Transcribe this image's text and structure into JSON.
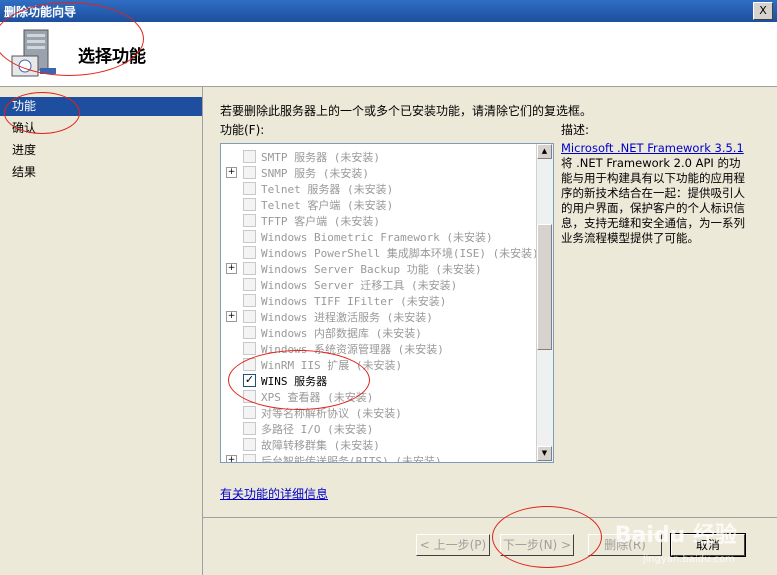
{
  "window": {
    "title": "删除功能向导",
    "close_label": "X"
  },
  "header": {
    "title": "选择功能"
  },
  "nav": {
    "items": [
      {
        "label": "功能"
      },
      {
        "label": "确认"
      },
      {
        "label": "进度"
      },
      {
        "label": "结果"
      }
    ]
  },
  "main": {
    "instruction": "若要删除此服务器上的一个或多个已安装功能，请清除它们的复选框。",
    "features_label": "功能(F):",
    "description_label": "描述:",
    "features": [
      {
        "label": "SMTP 服务器  (未安装)",
        "expander": false,
        "checked": false
      },
      {
        "label": "SNMP 服务  (未安装)",
        "expander": true,
        "checked": false
      },
      {
        "label": "Telnet 服务器  (未安装)",
        "expander": false,
        "checked": false
      },
      {
        "label": "Telnet 客户端  (未安装)",
        "expander": false,
        "checked": false
      },
      {
        "label": "TFTP 客户端  (未安装)",
        "expander": false,
        "checked": false
      },
      {
        "label": "Windows Biometric Framework  (未安装)",
        "expander": false,
        "checked": false
      },
      {
        "label": "Windows PowerShell 集成脚本环境(ISE)  (未安装)",
        "expander": false,
        "checked": false
      },
      {
        "label": "Windows Server Backup 功能  (未安装)",
        "expander": true,
        "checked": false
      },
      {
        "label": "Windows Server 迁移工具  (未安装)",
        "expander": false,
        "checked": false
      },
      {
        "label": "Windows TIFF IFilter  (未安装)",
        "expander": false,
        "checked": false
      },
      {
        "label": "Windows 进程激活服务  (未安装)",
        "expander": true,
        "checked": false
      },
      {
        "label": "Windows 内部数据库  (未安装)",
        "expander": false,
        "checked": false
      },
      {
        "label": "Windows 系统资源管理器  (未安装)",
        "expander": false,
        "checked": false
      },
      {
        "label": "WinRM IIS 扩展  (未安装)",
        "expander": false,
        "checked": false
      },
      {
        "label": "WINS 服务器",
        "expander": false,
        "checked": true
      },
      {
        "label": "XPS 查看器  (未安装)",
        "expander": false,
        "checked": false
      },
      {
        "label": "对等名称解析协议  (未安装)",
        "expander": false,
        "checked": false
      },
      {
        "label": "多路径 I/O  (未安装)",
        "expander": false,
        "checked": false
      },
      {
        "label": "故障转移群集  (未安装)",
        "expander": false,
        "checked": false
      },
      {
        "label": "后台智能传送服务(BITS)  (未安装)",
        "expander": true,
        "checked": false
      }
    ],
    "description_link": "Microsoft .NET Framework 3.5.1",
    "description_text": "将 .NET Framework 2.0 API 的功能与用于构建具有以下功能的应用程序的新技术结合在一起：提供吸引人的用户界面，保护客户的个人标识信息，支持无缝和安全通信，为一系列业务流程模型提供了可能。",
    "more_info_link": "有关功能的详细信息"
  },
  "buttons": {
    "previous": "< 上一步(P)",
    "next": "下一步(N) >",
    "delete": "删除(R)",
    "cancel": "取消"
  },
  "watermark": {
    "brand": "Baidu 经验",
    "url": "jingyan.baidu.com"
  },
  "colors": {
    "selection": "#1d4f9e",
    "annotation": "#e0241b",
    "link": "#0000cc"
  }
}
